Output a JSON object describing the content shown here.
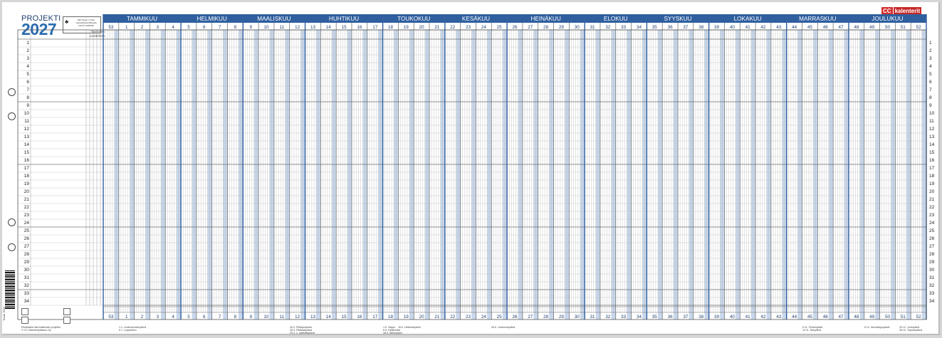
{
  "header": {
    "title": "PROJEKTI",
    "year": "2027",
    "fsc_text": "MIX Paper | Tuotu vastuullisista lähteistä FSC® C008786",
    "logo_cc": "CC",
    "logo_text": "kalenterit",
    "col_label_line1": "TEHTÄVÄ",
    "col_label_line2": "LUOKITUS"
  },
  "months": [
    "TAMMIKUU",
    "HELMIKUU",
    "MAALISKUU",
    "HUHTIKUU",
    "TOUKOKUU",
    "KESÄKUU",
    "HEINÄKUU",
    "ELOKUU",
    "SYYSKUU",
    "LOKAKUU",
    "MARRASKUU",
    "JOULUKUU"
  ],
  "weeks": [
    "53",
    "1",
    "2",
    "3",
    "4",
    "5",
    "6",
    "7",
    "8",
    "9",
    "10",
    "11",
    "12",
    "13",
    "14",
    "15",
    "16",
    "17",
    "18",
    "19",
    "20",
    "21",
    "22",
    "23",
    "24",
    "25",
    "26",
    "27",
    "28",
    "29",
    "30",
    "31",
    "32",
    "33",
    "34",
    "35",
    "36",
    "37",
    "38",
    "39",
    "40",
    "41",
    "42",
    "43",
    "44",
    "45",
    "46",
    "47",
    "48",
    "49",
    "50",
    "51",
    "52"
  ],
  "month_week_counts": [
    5,
    4,
    4,
    5,
    4,
    4,
    5,
    4,
    4,
    5,
    4,
    5
  ],
  "rows": [
    "1",
    "2",
    "3",
    "4",
    "5",
    "6",
    "7",
    "8",
    "9",
    "10",
    "11",
    "12",
    "13",
    "14",
    "15",
    "16",
    "17",
    "18",
    "19",
    "20",
    "21",
    "22",
    "23",
    "24",
    "25",
    "26",
    "27",
    "28",
    "29",
    "30",
    "31",
    "32",
    "33",
    "34"
  ],
  "footer": {
    "left_line1": "Pikatilaisia lisä lisäkentän projektin",
    "left_line2": "© CC Kalenterijulkaisu Oy",
    "holidays": [
      {
        "w": 1,
        "lines": [
          "1.1. Uudenvuodenpäivä",
          "6.1. Loppiainen"
        ]
      },
      {
        "w": 12,
        "lines": [
          "26.3. Pitkäperjantai",
          "28.3. Pääsiäispäivä",
          "29.3. 2. pääsiäispäivä"
        ]
      },
      {
        "w": 18,
        "lines": [
          "1.5. Vappu",
          "6.5. Helatorstai",
          "16.5. Äitienpäivä"
        ]
      },
      {
        "w": 19,
        "lines": [
          "16.5. Helluntaipäivä"
        ]
      },
      {
        "w": 25,
        "lines": [
          "26.6. Juhannuspäivä"
        ]
      },
      {
        "w": 45,
        "lines": [
          "6.11. Pyhäinpäivä",
          "14.11. Isänpäivä"
        ]
      },
      {
        "w": 49,
        "lines": [
          "6.12. Itsenäisyyspäivä"
        ]
      },
      {
        "w": 52,
        "lines": [
          "25.12. Joulupäivä",
          "26.12. Tapaninpäivä"
        ]
      }
    ],
    "barcode_text": "Tuote 7027"
  },
  "colors": {
    "month_bar": "#2f5f9e",
    "weekend_shade": "#bed0e8",
    "week_num_text": "#1f3f6e",
    "grid_line": "#9a9a9a"
  }
}
